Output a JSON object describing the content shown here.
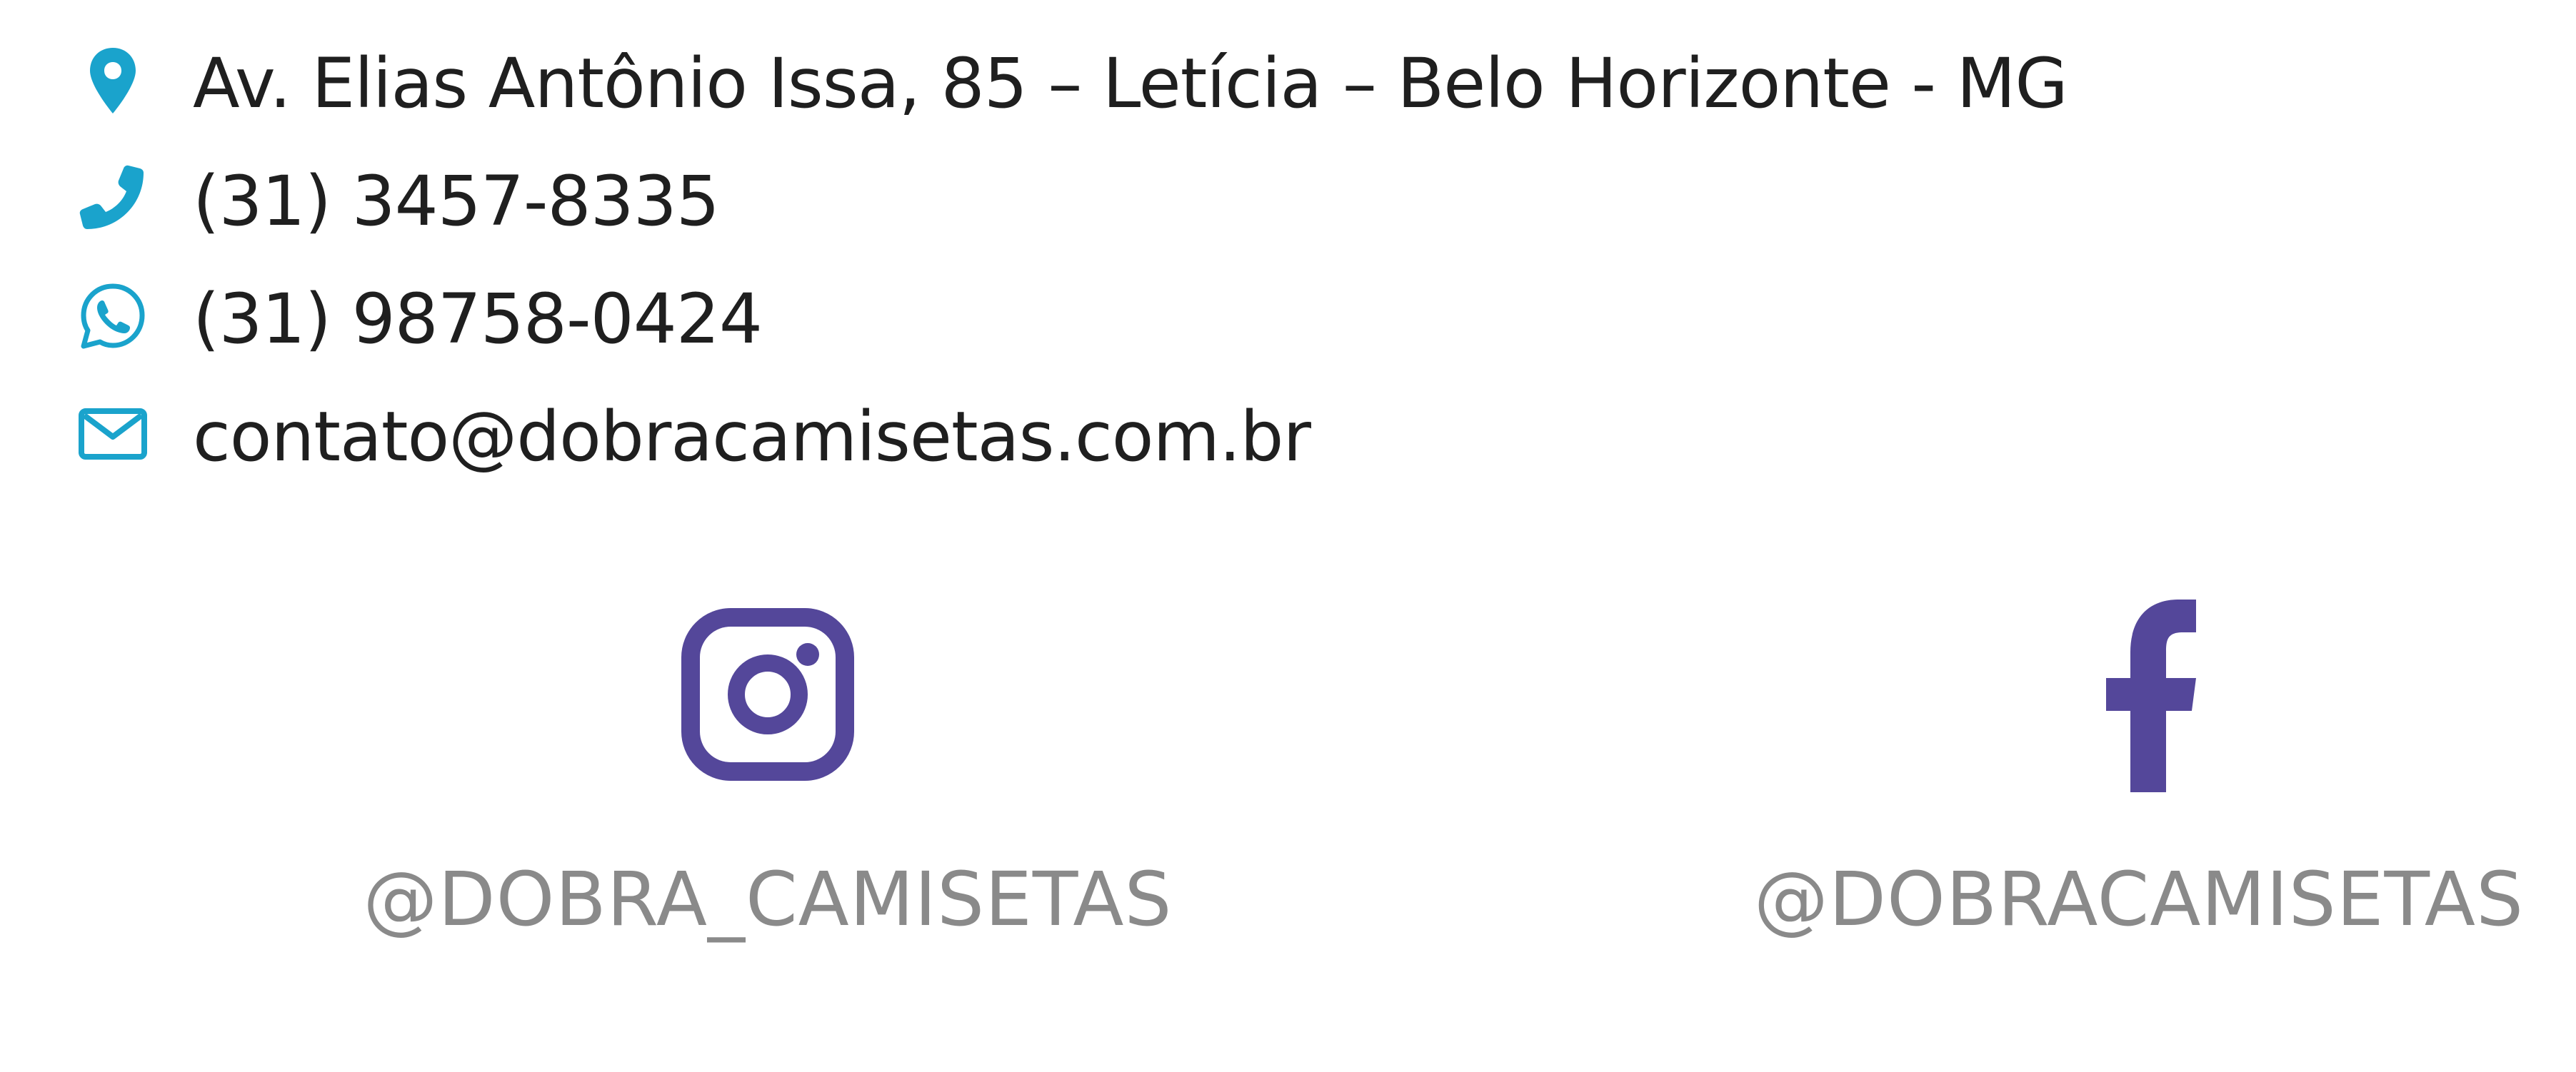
{
  "contact": {
    "address": "Av. Elias Antônio Issa, 85 – Letícia – Belo Horizonte - MG",
    "phone": "(31) 3457-8335",
    "whatsapp": "(31) 98758-0424",
    "email": "contato@dobracamisetas.com.br"
  },
  "social": {
    "instagram_handle": "@DOBRA_CAMISETAS",
    "facebook_handle": "@DOBRACAMISETAS"
  },
  "icons": {
    "address": "map-pin-icon",
    "phone": "phone-icon",
    "whatsapp": "whatsapp-icon",
    "email": "envelope-icon",
    "instagram": "instagram-icon",
    "facebook": "facebook-icon"
  },
  "colors": {
    "contact_icon": "#1aa3cc",
    "social_icon": "#54479a",
    "contact_text": "#1f1f1f",
    "social_text": "#8a8a8a",
    "background": "#ffffff"
  }
}
